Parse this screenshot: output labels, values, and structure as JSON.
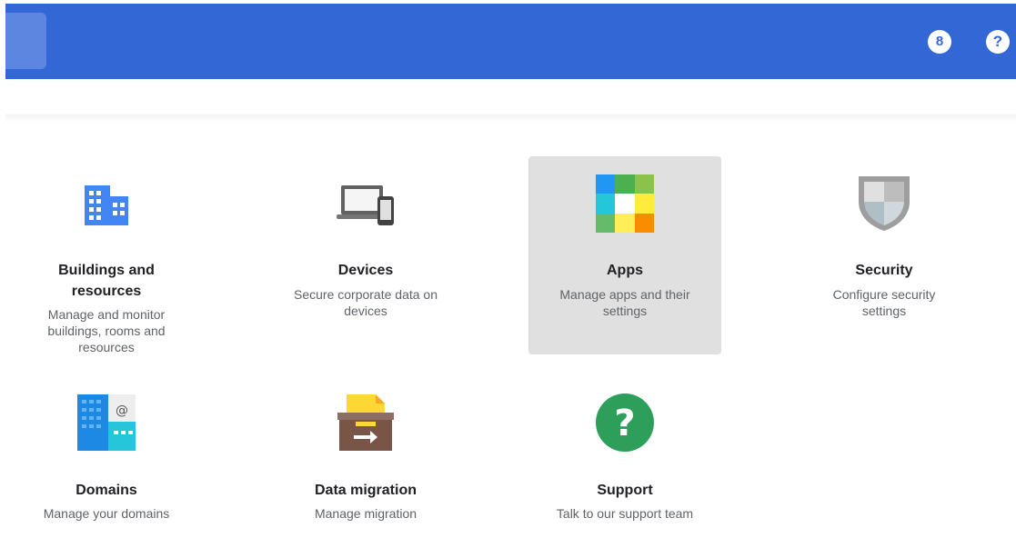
{
  "header": {
    "hourglass_glyph": "8",
    "help_glyph": "?",
    "color": "#3367d6"
  },
  "cards": [
    {
      "title": "Buildings and resources",
      "desc": "Manage and monitor buildings, rooms and resources",
      "icon": "building-icon"
    },
    {
      "title": "Devices",
      "desc": "Secure corporate data on devices",
      "icon": "devices-icon"
    },
    {
      "title": "Apps",
      "desc": "Manage apps and their settings",
      "icon": "apps-icon",
      "active": true
    },
    {
      "title": "Security",
      "desc": "Configure security settings",
      "icon": "shield-icon"
    },
    {
      "title": "Domains",
      "desc": "Manage your domains",
      "icon": "domains-icon"
    },
    {
      "title": "Data migration",
      "desc": "Manage migration",
      "icon": "data-migration-icon"
    },
    {
      "title": "Support",
      "desc": "Talk to our support team",
      "icon": "support-icon"
    }
  ]
}
